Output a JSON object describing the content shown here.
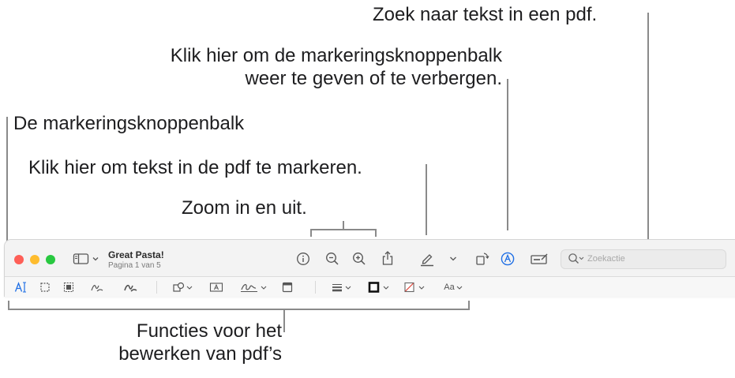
{
  "callouts": {
    "search": "Zoek naar tekst in een pdf.",
    "toggle_markup_line1": "Klik hier om de markeringsknoppenbalk",
    "toggle_markup_line2": "weer te geven of te verbergen.",
    "markup_toolbar": "De markeringsknoppenbalk",
    "highlight": "Klik hier om tekst in de pdf te markeren.",
    "zoom": "Zoom in en uit.",
    "edit_line1": "Functies voor het",
    "edit_line2": "bewerken van pdf’s"
  },
  "window": {
    "title": "Great Pasta!",
    "subtitle": "Pagina 1 van 5",
    "search_placeholder": "Zoekactie",
    "text_style_label": "Aa"
  },
  "colors": {
    "close": "#fe5f57",
    "minimize": "#febc2e",
    "zoom": "#28c840",
    "accent": "#1f6fe5",
    "leader": "#8a8a8a"
  },
  "icons": {
    "toolbar": [
      "sidebar-icon",
      "info-icon",
      "zoom-out-icon",
      "zoom-in-icon",
      "share-icon",
      "highlight-pen-icon",
      "rotate-icon",
      "markup-icon",
      "form-fill-icon",
      "search-icon"
    ],
    "markup": [
      "text-selection-icon",
      "rect-selection-icon",
      "instant-alpha-icon",
      "sketch-icon",
      "draw-icon",
      "shapes-icon",
      "text-box-icon",
      "sign-icon",
      "note-icon",
      "shape-style-icon",
      "border-color-icon",
      "fill-color-icon",
      "text-style-icon"
    ]
  }
}
